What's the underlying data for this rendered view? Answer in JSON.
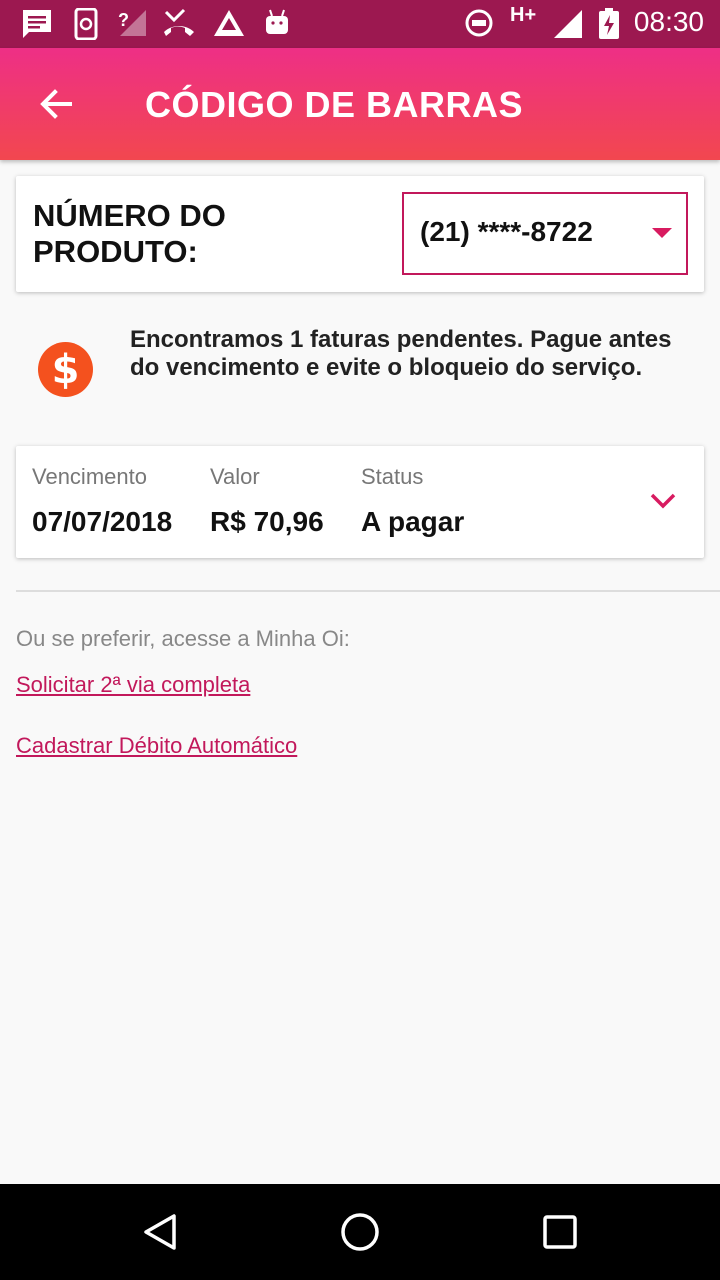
{
  "status_bar": {
    "time": "08:30",
    "network": "H+",
    "icons": [
      "message-icon",
      "phone-sync-icon",
      "no-signal-icon",
      "missed-call-icon",
      "app-icon",
      "android-icon",
      "do-not-disturb-icon",
      "signal-icon",
      "battery-charging-icon"
    ]
  },
  "app_bar": {
    "title": "CÓDIGO DE BARRAS",
    "back_icon": "arrow-back-icon"
  },
  "product": {
    "label": "NÚMERO DO PRODUTO:",
    "selected_value": "(21) ****-8722",
    "dropdown_icon": "dropdown-arrow-icon"
  },
  "notice": {
    "icon": "dollar-icon",
    "icon_symbol": "$",
    "text": "Encontramos 1 faturas pendentes. Pague antes do vencimento e evite o bloqueio do serviço."
  },
  "invoice": {
    "columns": [
      {
        "label": "Vencimento",
        "value": "07/07/2018"
      },
      {
        "label": "Valor",
        "value": "R$ 70,96"
      },
      {
        "label": "Status",
        "value": "A pagar"
      }
    ],
    "expand_icon": "chevron-down-icon"
  },
  "alternatives": {
    "intro": "Ou se preferir, acesse a Minha Oi:",
    "links": [
      {
        "label": "Solicitar 2ª via completa"
      },
      {
        "label": "Cadastrar Débito Automático"
      }
    ]
  },
  "nav_bar": {
    "buttons": [
      "back-triangle-icon",
      "home-circle-icon",
      "recents-square-icon"
    ]
  },
  "colors": {
    "status_bar": "#9c1850",
    "app_bar_top": "#ee2f86",
    "app_bar_bottom": "#f2474f",
    "accent": "#c2185b",
    "dollar_icon": "#f4511e"
  }
}
